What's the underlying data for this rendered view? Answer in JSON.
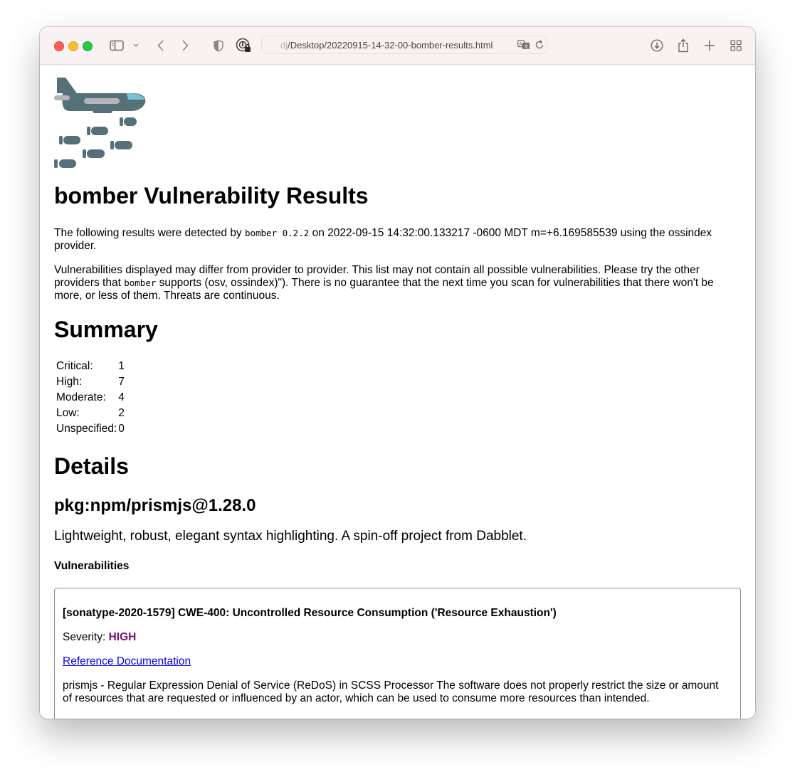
{
  "browser": {
    "url_dim": "dj",
    "url_path": "/Desktop/20220915-14-32-00-bomber-results.html"
  },
  "page": {
    "title": "bomber Vulnerability Results",
    "intro": {
      "prefix": "The following results were detected by ",
      "tool": "bomber 0.2.2",
      "suffix": " on 2022-09-15 14:32:00.133217 -0600 MDT m=+6.169585539 using the ossindex provider."
    },
    "disclaimer": {
      "prefix": "Vulnerabilities displayed may differ from provider to provider. This list may not contain all possible vulnerabilities. Please try the other providers that ",
      "tool": "bomber",
      "suffix": " supports (osv, ossindex)\"). There is no guarantee that the next time you scan for vulnerabilities that there won't be more, or less of them. Threats are continuous."
    },
    "summary_heading": "Summary",
    "summary": [
      {
        "label": "Critical:",
        "value": "1"
      },
      {
        "label": "High:",
        "value": "7"
      },
      {
        "label": "Moderate:",
        "value": "4"
      },
      {
        "label": "Low:",
        "value": "2"
      },
      {
        "label": "Unspecified:",
        "value": "0"
      }
    ],
    "details_heading": "Details",
    "package": {
      "name": "pkg:npm/prismjs@1.28.0",
      "description": "Lightweight, robust, elegant syntax highlighting. A spin-off project from Dabblet.",
      "vulns_heading": "Vulnerabilities",
      "vulnerability": {
        "title": "[sonatype-2020-1579] CWE-400: Uncontrolled Resource Consumption ('Resource Exhaustion')",
        "severity_label": "Severity: ",
        "severity": "HIGH",
        "severity_color": "#7b0f7f",
        "reference": "Reference Documentation",
        "description": "prismjs - Regular Expression Denial of Service (ReDoS) in SCSS Processor The software does not properly restrict the size or amount of resources that are requested or influenced by an actor, which can be used to consume more resources than intended."
      }
    }
  },
  "icons": [
    "sidebar-icon",
    "chevron-down-icon",
    "back-icon",
    "forward-icon",
    "shield-icon",
    "password-icon",
    "translate-icon",
    "reload-icon",
    "download-icon",
    "share-icon",
    "new-tab-icon",
    "tab-overview-icon",
    "bomber-logo"
  ]
}
